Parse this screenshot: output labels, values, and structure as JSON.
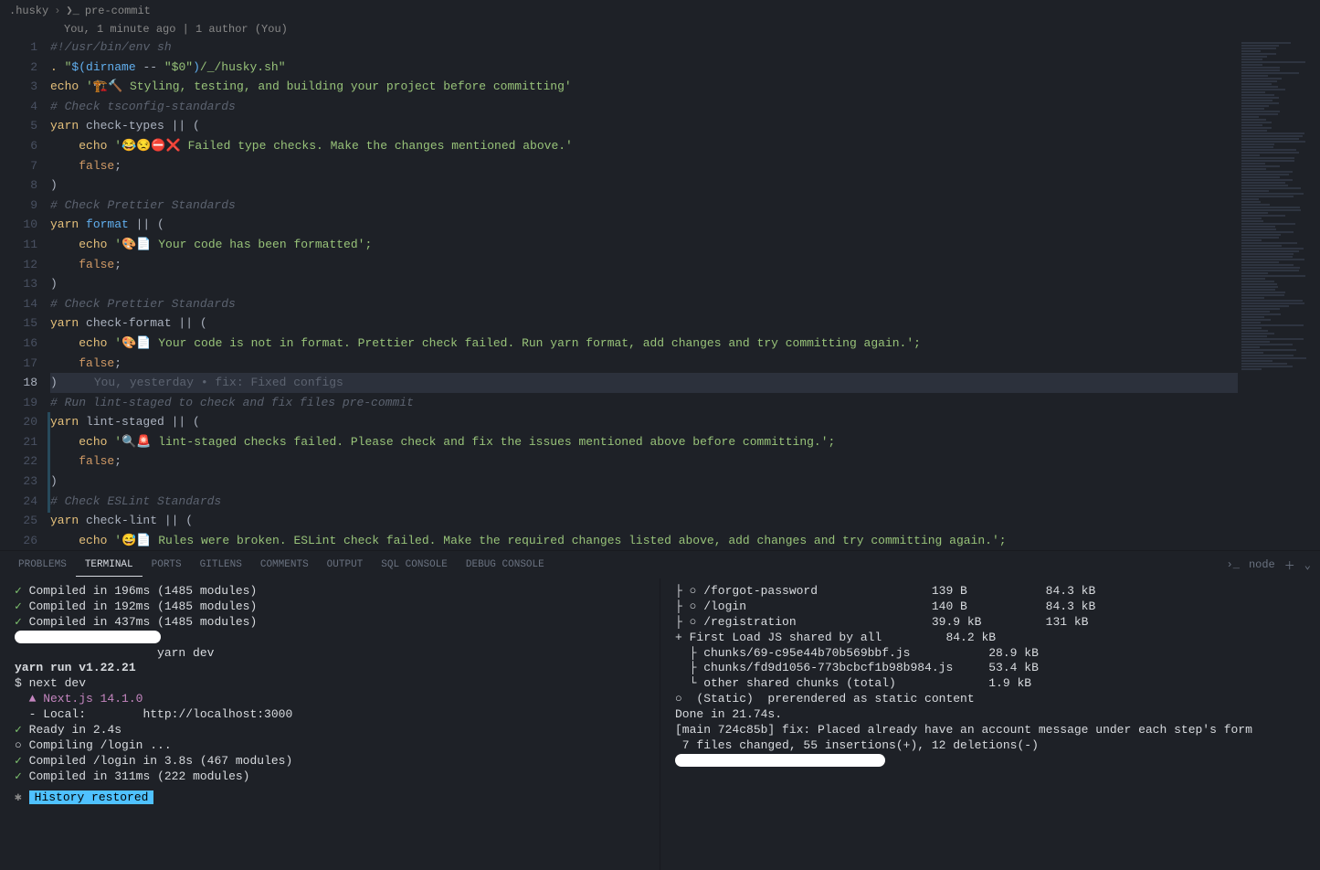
{
  "breadcrumb": {
    "folder": ".husky",
    "file": "pre-commit"
  },
  "gitlens_top": "You, 1 minute ago | 1 author (You)",
  "editor_lines": [
    {
      "n": 1,
      "tokens": [
        [
          "#!/usr/bin/env sh",
          "c"
        ]
      ]
    },
    {
      "n": 2,
      "tokens": [
        [
          ". ",
          "y"
        ],
        [
          "\"",
          "g"
        ],
        [
          "$(",
          "b"
        ],
        [
          "dirname",
          "b"
        ],
        [
          " -- ",
          "w"
        ],
        [
          "\"$0\"",
          "g"
        ],
        [
          ")",
          "b"
        ],
        [
          "/_/husky.sh\"",
          "g"
        ]
      ]
    },
    {
      "n": 3,
      "tokens": [
        [
          "echo",
          "y"
        ],
        [
          " '🏗️🔨 Styling, testing, and building your project before committing'",
          "g"
        ]
      ]
    },
    {
      "n": 4,
      "tokens": [
        [
          "# Check tsconfig-standards",
          "c"
        ]
      ]
    },
    {
      "n": 5,
      "tokens": [
        [
          "yarn",
          "y"
        ],
        [
          " check-types || (",
          "w"
        ]
      ]
    },
    {
      "n": 6,
      "tokens": [
        [
          "    ",
          "w"
        ],
        [
          "echo",
          "y"
        ],
        [
          " '😂😒⛔❌ Failed type checks. Make the changes mentioned above.'",
          "g"
        ]
      ]
    },
    {
      "n": 7,
      "tokens": [
        [
          "    ",
          "w"
        ],
        [
          "false",
          "o"
        ],
        [
          ";",
          "w"
        ]
      ]
    },
    {
      "n": 8,
      "tokens": [
        [
          ")",
          "w"
        ]
      ]
    },
    {
      "n": 9,
      "tokens": [
        [
          "# Check Prettier Standards",
          "c"
        ]
      ]
    },
    {
      "n": 10,
      "tokens": [
        [
          "yarn",
          "y"
        ],
        [
          " format",
          "b"
        ],
        [
          " || (",
          "w"
        ]
      ]
    },
    {
      "n": 11,
      "tokens": [
        [
          "    ",
          "w"
        ],
        [
          "echo",
          "y"
        ],
        [
          " '🎨📄 Your code has been formatted';",
          "g"
        ]
      ]
    },
    {
      "n": 12,
      "tokens": [
        [
          "    ",
          "w"
        ],
        [
          "false",
          "o"
        ],
        [
          ";",
          "w"
        ]
      ]
    },
    {
      "n": 13,
      "tokens": [
        [
          ")",
          "w"
        ]
      ]
    },
    {
      "n": 14,
      "tokens": [
        [
          "# Check Prettier Standards",
          "c"
        ]
      ]
    },
    {
      "n": 15,
      "tokens": [
        [
          "yarn",
          "y"
        ],
        [
          " check-format || ",
          "w"
        ],
        [
          "(",
          "w"
        ]
      ]
    },
    {
      "n": 16,
      "tokens": [
        [
          "    ",
          "w"
        ],
        [
          "echo",
          "y"
        ],
        [
          " '🎨📄 Your code is not in format. Prettier check failed. Run yarn format, add changes and try committing again.';",
          "g"
        ]
      ]
    },
    {
      "n": 17,
      "tokens": [
        [
          "    ",
          "w"
        ],
        [
          "false",
          "o"
        ],
        [
          ";",
          "w"
        ]
      ]
    },
    {
      "n": 18,
      "tokens": [
        [
          ")",
          "w"
        ]
      ],
      "active": true,
      "blame": "You, yesterday • fix: Fixed configs"
    },
    {
      "n": 19,
      "tokens": [
        [
          "# Run lint-staged to check and fix files pre-commit",
          "c"
        ]
      ]
    },
    {
      "n": 20,
      "tokens": [
        [
          "yarn",
          "y"
        ],
        [
          " lint-staged || (",
          "w"
        ]
      ]
    },
    {
      "n": 21,
      "tokens": [
        [
          "    ",
          "w"
        ],
        [
          "echo",
          "y"
        ],
        [
          " '🔍🚨 lint-staged checks failed. Please check and fix the issues mentioned above before committing.';",
          "g"
        ]
      ]
    },
    {
      "n": 22,
      "tokens": [
        [
          "    ",
          "w"
        ],
        [
          "false",
          "o"
        ],
        [
          ";",
          "w"
        ]
      ]
    },
    {
      "n": 23,
      "tokens": [
        [
          ")",
          "w"
        ]
      ]
    },
    {
      "n": 24,
      "tokens": [
        [
          "# Check ESLint Standards",
          "c"
        ]
      ]
    },
    {
      "n": 25,
      "tokens": [
        [
          "yarn",
          "y"
        ],
        [
          " check-lint || (",
          "w"
        ]
      ]
    },
    {
      "n": 26,
      "tokens": [
        [
          "    ",
          "w"
        ],
        [
          "echo",
          "y"
        ],
        [
          " '😅📄 Rules were broken. ESLint check failed. Make the required changes listed above, add changes and try committing again.';",
          "g"
        ]
      ]
    }
  ],
  "panel": {
    "tabs": [
      "PROBLEMS",
      "TERMINAL",
      "PORTS",
      "GITLENS",
      "COMMENTS",
      "OUTPUT",
      "SQL CONSOLE",
      "DEBUG CONSOLE"
    ],
    "active_tab": "TERMINAL",
    "shell_label": "node"
  },
  "terminal_left": {
    "compiled": [
      "Compiled in 196ms (1485 modules)",
      "Compiled in 192ms (1485 modules)",
      "Compiled in 437ms (1485 modules)"
    ],
    "yarn_dev": "yarn dev",
    "yarn_run": "yarn run v1.22.21",
    "next_dev": "$ next dev",
    "next_ver": "  ▲ Next.js 14.1.0",
    "local_label": "  - Local:        ",
    "local_url": "http://localhost:3000",
    "ready": "Ready in 2.4s",
    "compiling": "○ Compiling /login ...",
    "compiled_login": "Compiled /login in 3.8s (467 modules)",
    "compiled_311": "Compiled in 311ms (222 modules)",
    "history": "History restored"
  },
  "terminal_right": {
    "routes": [
      {
        "sym": "○",
        "path": "/forgot-password",
        "size": "139 B",
        "first": "84.3 kB"
      },
      {
        "sym": "○",
        "path": "/login",
        "size": "140 B",
        "first": "84.3 kB"
      },
      {
        "sym": "○",
        "path": "/registration",
        "size": "39.9 kB",
        "first": "131 kB"
      }
    ],
    "first_load": {
      "label": "+ First Load JS shared by all",
      "size": "84.2 kB"
    },
    "chunks": [
      {
        "label": "  ├ chunks/69-c95e44b70b569bbf.js",
        "size": "28.9 kB"
      },
      {
        "label": "  ├ chunks/fd9d1056-773bcbcf1b98b984.js",
        "size": "53.4 kB"
      },
      {
        "label": "  └ other shared chunks (total)",
        "size": "1.9 kB"
      }
    ],
    "static": "○  (Static)  prerendered as static content",
    "done": "Done in 21.74s.",
    "commit": "[main 724c85b] fix: Placed already have an account message under each step's form",
    "files": " 7 files changed, 55 insertions(+), 12 deletions(-)"
  }
}
